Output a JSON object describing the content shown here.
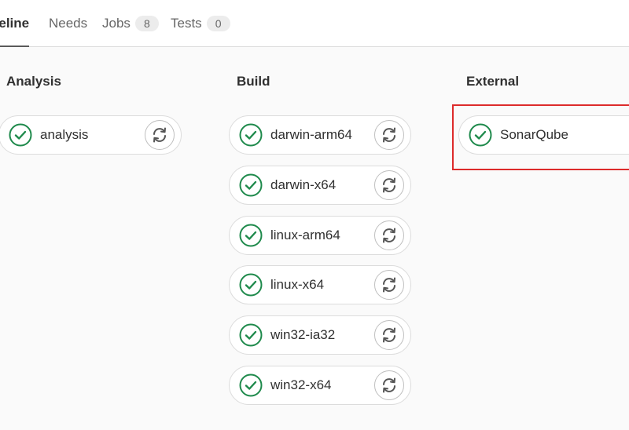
{
  "tabs": [
    {
      "label": "peline",
      "active": true
    },
    {
      "label": "Needs",
      "active": false
    },
    {
      "label": "Jobs",
      "count": "8",
      "active": false
    },
    {
      "label": "Tests",
      "count": "0",
      "active": false
    }
  ],
  "stages": [
    {
      "title": "Analysis",
      "jobs": [
        {
          "name": "analysis",
          "status": "passed"
        }
      ]
    },
    {
      "title": "Build",
      "jobs": [
        {
          "name": "darwin-arm64",
          "status": "passed"
        },
        {
          "name": "darwin-x64",
          "status": "passed"
        },
        {
          "name": "linux-arm64",
          "status": "passed"
        },
        {
          "name": "linux-x64",
          "status": "passed"
        },
        {
          "name": "win32-ia32",
          "status": "passed"
        },
        {
          "name": "win32-x64",
          "status": "passed"
        }
      ]
    },
    {
      "title": "External",
      "jobs": [
        {
          "name": "SonarQube",
          "status": "passed"
        }
      ]
    }
  ],
  "colors": {
    "success": "#1f8a4c",
    "highlight": "#dd2b2b"
  },
  "icons": {
    "status": "check-circle-icon",
    "retry": "retry-icon"
  }
}
